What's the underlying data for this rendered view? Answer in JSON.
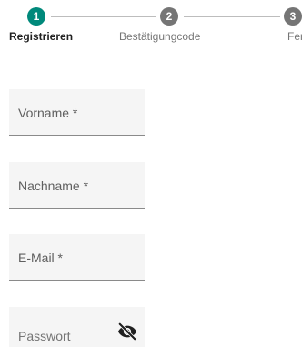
{
  "stepper": {
    "steps": [
      {
        "number": "1",
        "label": "Registrieren",
        "state": "active"
      },
      {
        "number": "2",
        "label": "Bestätigungcode",
        "state": "inactive"
      },
      {
        "number": "3",
        "label": "Fertig",
        "state": "inactive"
      }
    ]
  },
  "form": {
    "fields": [
      {
        "label": "Vorname *"
      },
      {
        "label": "Nachname *"
      },
      {
        "label": "E-Mail *"
      },
      {
        "label": "Passwort",
        "icon": "eye-slash-icon"
      }
    ]
  },
  "colors": {
    "accent": "#00897b",
    "inactive_step": "#757575",
    "field_background": "#f5f5f5"
  }
}
